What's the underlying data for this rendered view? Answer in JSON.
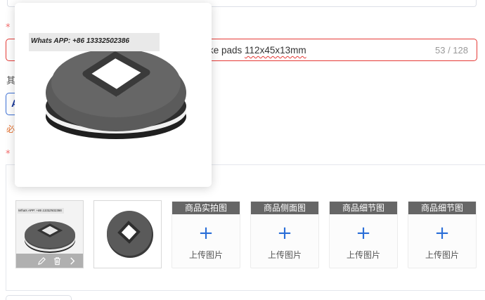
{
  "title_field": {
    "value_visible": "ke pads ",
    "value_tail": "112x45x13mm",
    "counter": "53 / 128"
  },
  "required_marks": [
    "*",
    "*"
  ],
  "side": {
    "label": "其",
    "button_letter": "A",
    "note": "必"
  },
  "popover": {
    "watermark": "Whats APP:   +86  13332502386"
  },
  "thumbnails": [
    {
      "watermark": "Whats APP:  +86  13332502386",
      "actions": [
        "edit-icon",
        "delete-icon",
        "more-icon"
      ]
    },
    {}
  ],
  "upload_slots": [
    {
      "header": "商品实拍图",
      "plus": "+",
      "label": "上传图片"
    },
    {
      "header": "商品侧面图",
      "plus": "+",
      "label": "上传图片"
    },
    {
      "header": "商品细节图",
      "plus": "+",
      "label": "上传图片"
    },
    {
      "header": "商品细节图",
      "plus": "+",
      "label": "上传图片"
    }
  ],
  "colors": {
    "error_border": "#e53935",
    "accent_blue": "#2b6fd8",
    "slot_header": "#666666",
    "required": "#f56c6c"
  }
}
